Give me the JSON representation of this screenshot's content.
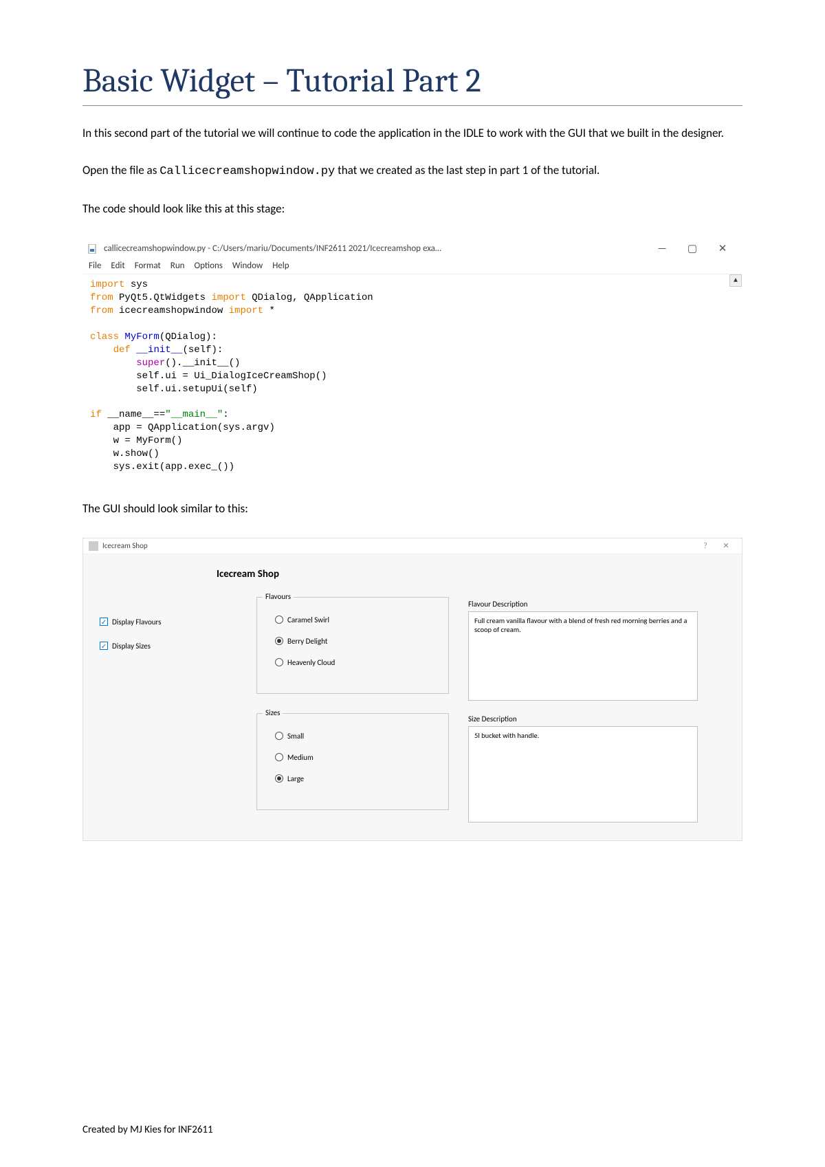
{
  "title": "Basic Widget – Tutorial Part 2",
  "intro": "In this second part of the tutorial we will continue to code the application in the IDLE to work with the GUI that we built in the designer.",
  "open_file_pre": "Open the file as ",
  "open_file_code": "Callicecreamshopwindow.py",
  "open_file_post": "  that we created as the last step in part 1 of the tutorial.",
  "code_intro": "The code should look like this at this stage:",
  "idle": {
    "window_title": "callicecreamshopwindow.py - C:/Users/mariu/Documents/INF2611 2021/Icecreamshop exa…",
    "minimize": "—",
    "maximize": "▢",
    "close": "✕",
    "menu": [
      "File",
      "Edit",
      "Format",
      "Run",
      "Options",
      "Window",
      "Help"
    ],
    "scroll_up": "▲"
  },
  "gui_intro": "The GUI should look similar to this:",
  "gui": {
    "window_title": "Icecream Shop",
    "help": "?",
    "close": "✕",
    "heading": "Icecream Shop",
    "checks": [
      {
        "label": "Display Flavours"
      },
      {
        "label": "Display Sizes"
      }
    ],
    "flavours_title": "Flavours",
    "flavours": [
      "Caramel Swirl",
      "Berry Delight",
      "Heavenly Cloud"
    ],
    "sizes_title": "Sizes",
    "sizes": [
      "Small",
      "Medium",
      "Large"
    ],
    "flav_desc_label": "Flavour Description",
    "flav_desc_text": "Full cream vanilla flavour with a blend of fresh red morning berries and a scoop of cream.",
    "size_desc_label": "Size Description",
    "size_desc_text": "5l bucket with handle."
  },
  "footer": "Created by MJ Kies for INF2611"
}
